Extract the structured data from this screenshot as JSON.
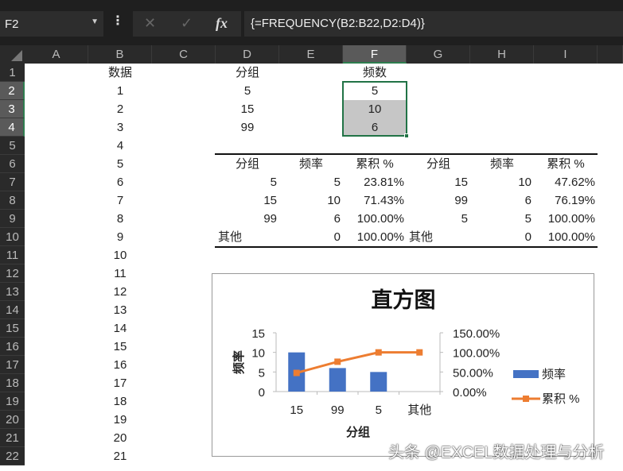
{
  "name_box": "F2",
  "formula_buttons": {
    "cancel": "✕",
    "enter": "✓",
    "fx": "fx"
  },
  "formula": "{=FREQUENCY(B2:B22,D2:D4)}",
  "columns": [
    "A",
    "B",
    "C",
    "D",
    "E",
    "F",
    "G",
    "H",
    "I"
  ],
  "selected_column": "F",
  "rows": [
    "1",
    "2",
    "3",
    "4",
    "5",
    "6",
    "7",
    "8",
    "9",
    "10",
    "11",
    "12",
    "13",
    "14",
    "15",
    "16",
    "17",
    "18",
    "19",
    "20",
    "21",
    "22"
  ],
  "headers": {
    "B1": "数据",
    "D1": "分组",
    "F1": "频数"
  },
  "column_b": [
    "1",
    "2",
    "3",
    "4",
    "5",
    "6",
    "7",
    "8",
    "9",
    "10",
    "11",
    "12",
    "13",
    "14",
    "15",
    "16",
    "17",
    "18",
    "19",
    "20",
    "21"
  ],
  "column_d": [
    "5",
    "15",
    "99"
  ],
  "column_f": [
    "5",
    "10",
    "6"
  ],
  "table": {
    "header": [
      "分组",
      "频率",
      "累积 %",
      "分组",
      "频率",
      "累积 %"
    ],
    "rows": [
      [
        "5",
        "5",
        "23.81%",
        "15",
        "10",
        "47.62%"
      ],
      [
        "15",
        "10",
        "71.43%",
        "99",
        "6",
        "76.19%"
      ],
      [
        "99",
        "6",
        "100.00%",
        "5",
        "5",
        "100.00%"
      ],
      [
        "其他",
        "0",
        "100.00%",
        "其他",
        "0",
        "100.00%"
      ]
    ]
  },
  "chart_data": {
    "type": "bar",
    "title": "直方图",
    "categories": [
      "15",
      "99",
      "5",
      "其他"
    ],
    "series": [
      {
        "name": "频率",
        "type": "bar",
        "axis": "left",
        "values": [
          10,
          6,
          5,
          0
        ],
        "color": "#4472c4"
      },
      {
        "name": "累积 %",
        "type": "line",
        "axis": "right",
        "values": [
          47.62,
          76.19,
          100,
          100
        ],
        "color": "#ed7d31"
      }
    ],
    "xlabel": "分组",
    "ylabel": "频率",
    "ylim": [
      0,
      15
    ],
    "yticks": [
      "0",
      "5",
      "10",
      "15"
    ],
    "y2lim": [
      0,
      150
    ],
    "y2ticks": [
      "0.00%",
      "50.00%",
      "100.00%",
      "150.00%"
    ],
    "legend": "right"
  },
  "watermark": "头条 @EXCEL数据处理与分析"
}
